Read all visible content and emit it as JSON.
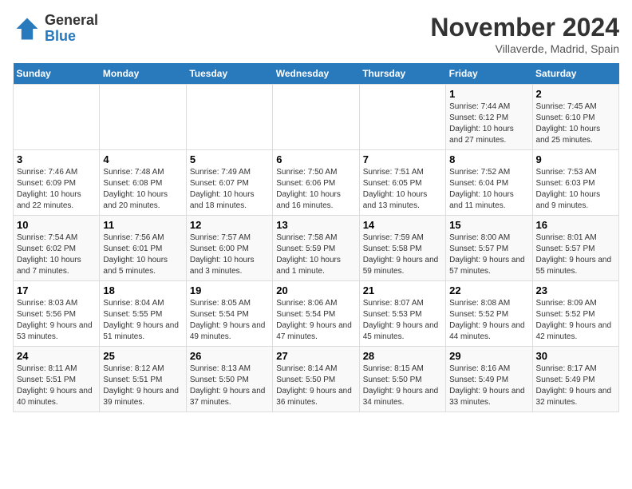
{
  "header": {
    "logo_general": "General",
    "logo_blue": "Blue",
    "month_title": "November 2024",
    "location": "Villaverde, Madrid, Spain"
  },
  "weekdays": [
    "Sunday",
    "Monday",
    "Tuesday",
    "Wednesday",
    "Thursday",
    "Friday",
    "Saturday"
  ],
  "weeks": [
    [
      {
        "day": "",
        "info": ""
      },
      {
        "day": "",
        "info": ""
      },
      {
        "day": "",
        "info": ""
      },
      {
        "day": "",
        "info": ""
      },
      {
        "day": "",
        "info": ""
      },
      {
        "day": "1",
        "info": "Sunrise: 7:44 AM\nSunset: 6:12 PM\nDaylight: 10 hours and 27 minutes."
      },
      {
        "day": "2",
        "info": "Sunrise: 7:45 AM\nSunset: 6:10 PM\nDaylight: 10 hours and 25 minutes."
      }
    ],
    [
      {
        "day": "3",
        "info": "Sunrise: 7:46 AM\nSunset: 6:09 PM\nDaylight: 10 hours and 22 minutes."
      },
      {
        "day": "4",
        "info": "Sunrise: 7:48 AM\nSunset: 6:08 PM\nDaylight: 10 hours and 20 minutes."
      },
      {
        "day": "5",
        "info": "Sunrise: 7:49 AM\nSunset: 6:07 PM\nDaylight: 10 hours and 18 minutes."
      },
      {
        "day": "6",
        "info": "Sunrise: 7:50 AM\nSunset: 6:06 PM\nDaylight: 10 hours and 16 minutes."
      },
      {
        "day": "7",
        "info": "Sunrise: 7:51 AM\nSunset: 6:05 PM\nDaylight: 10 hours and 13 minutes."
      },
      {
        "day": "8",
        "info": "Sunrise: 7:52 AM\nSunset: 6:04 PM\nDaylight: 10 hours and 11 minutes."
      },
      {
        "day": "9",
        "info": "Sunrise: 7:53 AM\nSunset: 6:03 PM\nDaylight: 10 hours and 9 minutes."
      }
    ],
    [
      {
        "day": "10",
        "info": "Sunrise: 7:54 AM\nSunset: 6:02 PM\nDaylight: 10 hours and 7 minutes."
      },
      {
        "day": "11",
        "info": "Sunrise: 7:56 AM\nSunset: 6:01 PM\nDaylight: 10 hours and 5 minutes."
      },
      {
        "day": "12",
        "info": "Sunrise: 7:57 AM\nSunset: 6:00 PM\nDaylight: 10 hours and 3 minutes."
      },
      {
        "day": "13",
        "info": "Sunrise: 7:58 AM\nSunset: 5:59 PM\nDaylight: 10 hours and 1 minute."
      },
      {
        "day": "14",
        "info": "Sunrise: 7:59 AM\nSunset: 5:58 PM\nDaylight: 9 hours and 59 minutes."
      },
      {
        "day": "15",
        "info": "Sunrise: 8:00 AM\nSunset: 5:57 PM\nDaylight: 9 hours and 57 minutes."
      },
      {
        "day": "16",
        "info": "Sunrise: 8:01 AM\nSunset: 5:57 PM\nDaylight: 9 hours and 55 minutes."
      }
    ],
    [
      {
        "day": "17",
        "info": "Sunrise: 8:03 AM\nSunset: 5:56 PM\nDaylight: 9 hours and 53 minutes."
      },
      {
        "day": "18",
        "info": "Sunrise: 8:04 AM\nSunset: 5:55 PM\nDaylight: 9 hours and 51 minutes."
      },
      {
        "day": "19",
        "info": "Sunrise: 8:05 AM\nSunset: 5:54 PM\nDaylight: 9 hours and 49 minutes."
      },
      {
        "day": "20",
        "info": "Sunrise: 8:06 AM\nSunset: 5:54 PM\nDaylight: 9 hours and 47 minutes."
      },
      {
        "day": "21",
        "info": "Sunrise: 8:07 AM\nSunset: 5:53 PM\nDaylight: 9 hours and 45 minutes."
      },
      {
        "day": "22",
        "info": "Sunrise: 8:08 AM\nSunset: 5:52 PM\nDaylight: 9 hours and 44 minutes."
      },
      {
        "day": "23",
        "info": "Sunrise: 8:09 AM\nSunset: 5:52 PM\nDaylight: 9 hours and 42 minutes."
      }
    ],
    [
      {
        "day": "24",
        "info": "Sunrise: 8:11 AM\nSunset: 5:51 PM\nDaylight: 9 hours and 40 minutes."
      },
      {
        "day": "25",
        "info": "Sunrise: 8:12 AM\nSunset: 5:51 PM\nDaylight: 9 hours and 39 minutes."
      },
      {
        "day": "26",
        "info": "Sunrise: 8:13 AM\nSunset: 5:50 PM\nDaylight: 9 hours and 37 minutes."
      },
      {
        "day": "27",
        "info": "Sunrise: 8:14 AM\nSunset: 5:50 PM\nDaylight: 9 hours and 36 minutes."
      },
      {
        "day": "28",
        "info": "Sunrise: 8:15 AM\nSunset: 5:50 PM\nDaylight: 9 hours and 34 minutes."
      },
      {
        "day": "29",
        "info": "Sunrise: 8:16 AM\nSunset: 5:49 PM\nDaylight: 9 hours and 33 minutes."
      },
      {
        "day": "30",
        "info": "Sunrise: 8:17 AM\nSunset: 5:49 PM\nDaylight: 9 hours and 32 minutes."
      }
    ]
  ]
}
